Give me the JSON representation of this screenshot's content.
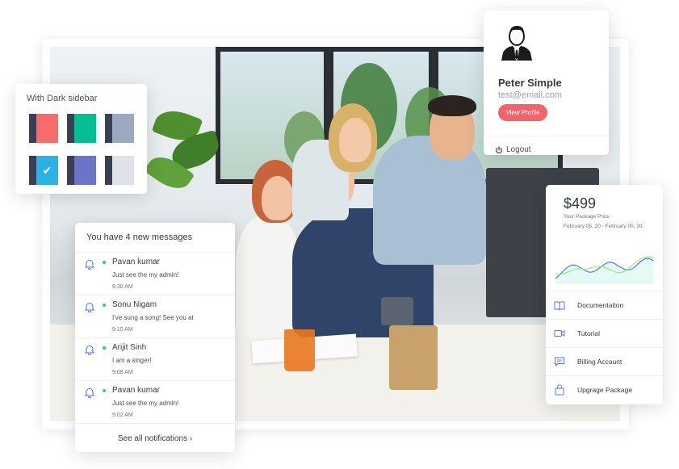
{
  "theme_panel": {
    "title": "With Dark sidebar",
    "swatches": [
      {
        "name": "red",
        "color": "#f76b6b",
        "selected": false
      },
      {
        "name": "teal",
        "color": "#07be93",
        "selected": false
      },
      {
        "name": "slate",
        "color": "#9aa8c2",
        "selected": false
      },
      {
        "name": "blue",
        "color": "#2ab2e6",
        "selected": true
      },
      {
        "name": "indigo",
        "color": "#6d73c9",
        "selected": false
      },
      {
        "name": "light-gray",
        "color": "#dfe2e6",
        "selected": false
      }
    ],
    "dark_color": "#3a3f51"
  },
  "profile": {
    "name": "Peter Simple",
    "email": "test@email.com",
    "view_profile_label": "View Profile",
    "logout_label": "Logout"
  },
  "messages": {
    "header": "You have 4 new messages",
    "items": [
      {
        "name": "Pavan kumar",
        "text": "Just see the my admin!",
        "time": "9:30 AM"
      },
      {
        "name": "Sonu Nigam",
        "text": "I've sung a song! See you at",
        "time": "9:10 AM"
      },
      {
        "name": "Arijit Sinh",
        "text": "I am a singer!",
        "time": "9:08 AM"
      },
      {
        "name": "Pavan kumar",
        "text": "Just see the my admin!",
        "time": "9:02 AM"
      }
    ],
    "see_all_label": "See all notifications ›"
  },
  "package": {
    "price": "$499",
    "subtitle": "Your Package Price",
    "date_range": "February 05, 20 - February 05, 20",
    "menu": [
      {
        "label": "Documentation",
        "icon": "book-icon"
      },
      {
        "label": "Tutorial",
        "icon": "video-icon"
      },
      {
        "label": "Billing Account",
        "icon": "chat-icon"
      },
      {
        "label": "Upgrage Package",
        "icon": "bag-icon"
      }
    ]
  },
  "colors": {
    "accent_red": "#f1646c",
    "accent_teal": "#1ecab8",
    "chart_blue": "#4d79f6",
    "chart_green": "#a3e76f"
  }
}
